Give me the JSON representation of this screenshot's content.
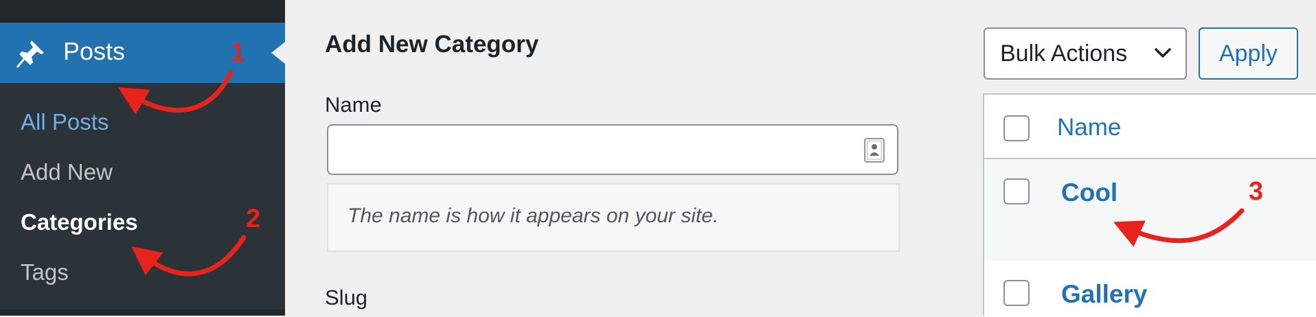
{
  "sidebar": {
    "menu_label": "Posts",
    "pin_icon": "pushpin-icon",
    "submenu": [
      {
        "label": "All Posts",
        "state": "hover"
      },
      {
        "label": "Add New",
        "state": "normal"
      },
      {
        "label": "Categories",
        "state": "current"
      },
      {
        "label": "Tags",
        "state": "normal"
      }
    ]
  },
  "form": {
    "title": "Add New Category",
    "name_label": "Name",
    "name_value": "",
    "name_help": "The name is how it appears on your site.",
    "slug_label": "Slug"
  },
  "toolbar": {
    "bulk_actions": "Bulk Actions",
    "apply": "Apply"
  },
  "table": {
    "column_name": "Name",
    "rows": [
      "Cool",
      "Gallery"
    ]
  },
  "annotations": {
    "step1": "1",
    "step2": "2",
    "step3": "3"
  },
  "colors": {
    "accent": "#2271b1",
    "sidebar": "#2c3338",
    "annotation": "#e8231b"
  }
}
